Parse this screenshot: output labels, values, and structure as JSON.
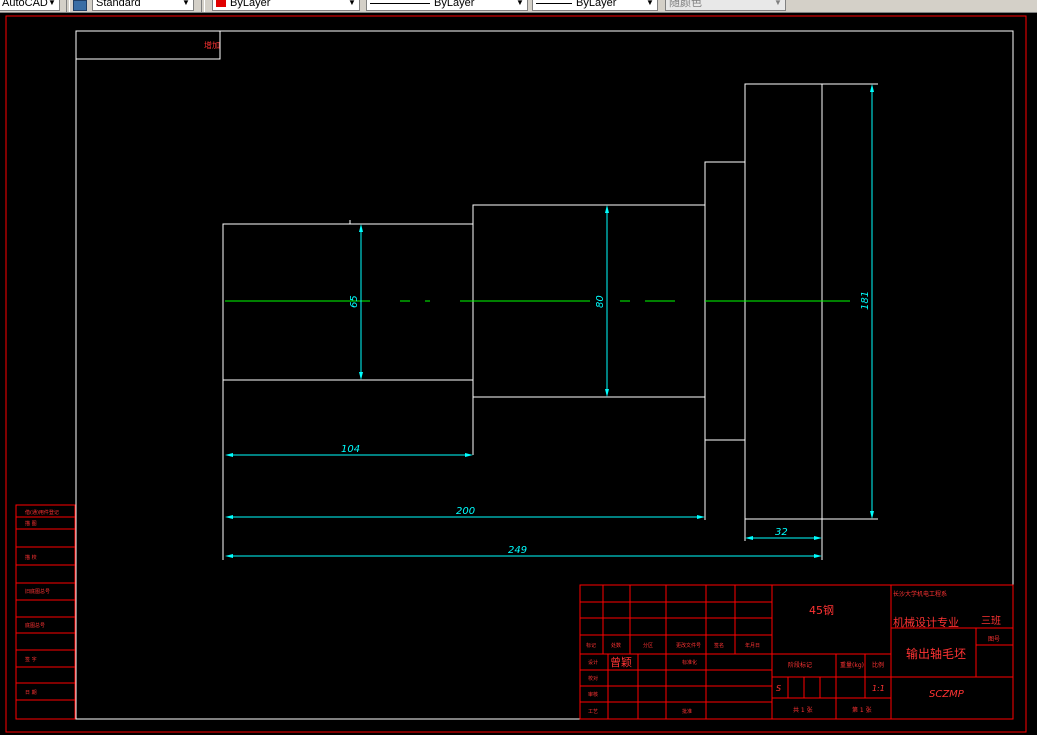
{
  "toolbar": {
    "style_combo": "AutoCAD",
    "text_style_combo": "Standard",
    "color_combo": "ByLayer",
    "linetype_combo": "ByLayer",
    "lineweight_combo": "ByLayer",
    "plotstyle_combo": "随颜色"
  },
  "drawing": {
    "corner_tag": "增加",
    "dimensions": {
      "d_left": "65",
      "d_mid": "80",
      "d_right": "181",
      "len_104": "104",
      "len_200": "200",
      "len_249": "249",
      "len_32": "32"
    },
    "left_strip": {
      "row1": "借(通)用件登记",
      "row2": "描  图",
      "row3": "描  校",
      "row4": "旧底图总号",
      "row5": "底图总号",
      "row6": "签  字",
      "row7": "日  期"
    },
    "title_block": {
      "material": "45钢",
      "university": "长沙大学机电工程系",
      "major": "机械设计专业",
      "class_label": "三班",
      "part_name": "输出轴毛坯",
      "drawing_no": "SCZMP",
      "designer": "曾颖",
      "stage_label": "阶段标记",
      "weight_label": "重量(kg)",
      "scale_label": "比例",
      "scale_value": "1:1",
      "stage_mark": "S",
      "total_sheets": "共 1 张",
      "sheet_no": "第 1 张",
      "header_mark": "标记",
      "header_count": "处数",
      "header_zone": "分区",
      "header_change": "更改文件号",
      "header_sign": "签名",
      "header_date": "年月日",
      "row_design": "设计",
      "row_std": "标准化",
      "row_check": "校对",
      "row_review": "审核",
      "row_process": "工艺",
      "row_approve": "批准",
      "drawing_type": "图号"
    }
  },
  "colors": {
    "background": "#000000",
    "frame": "#ff0000",
    "outline": "#ffffff",
    "dimension": "#00ffff",
    "centerline": "#00ff00",
    "title_text": "#ff3333"
  }
}
